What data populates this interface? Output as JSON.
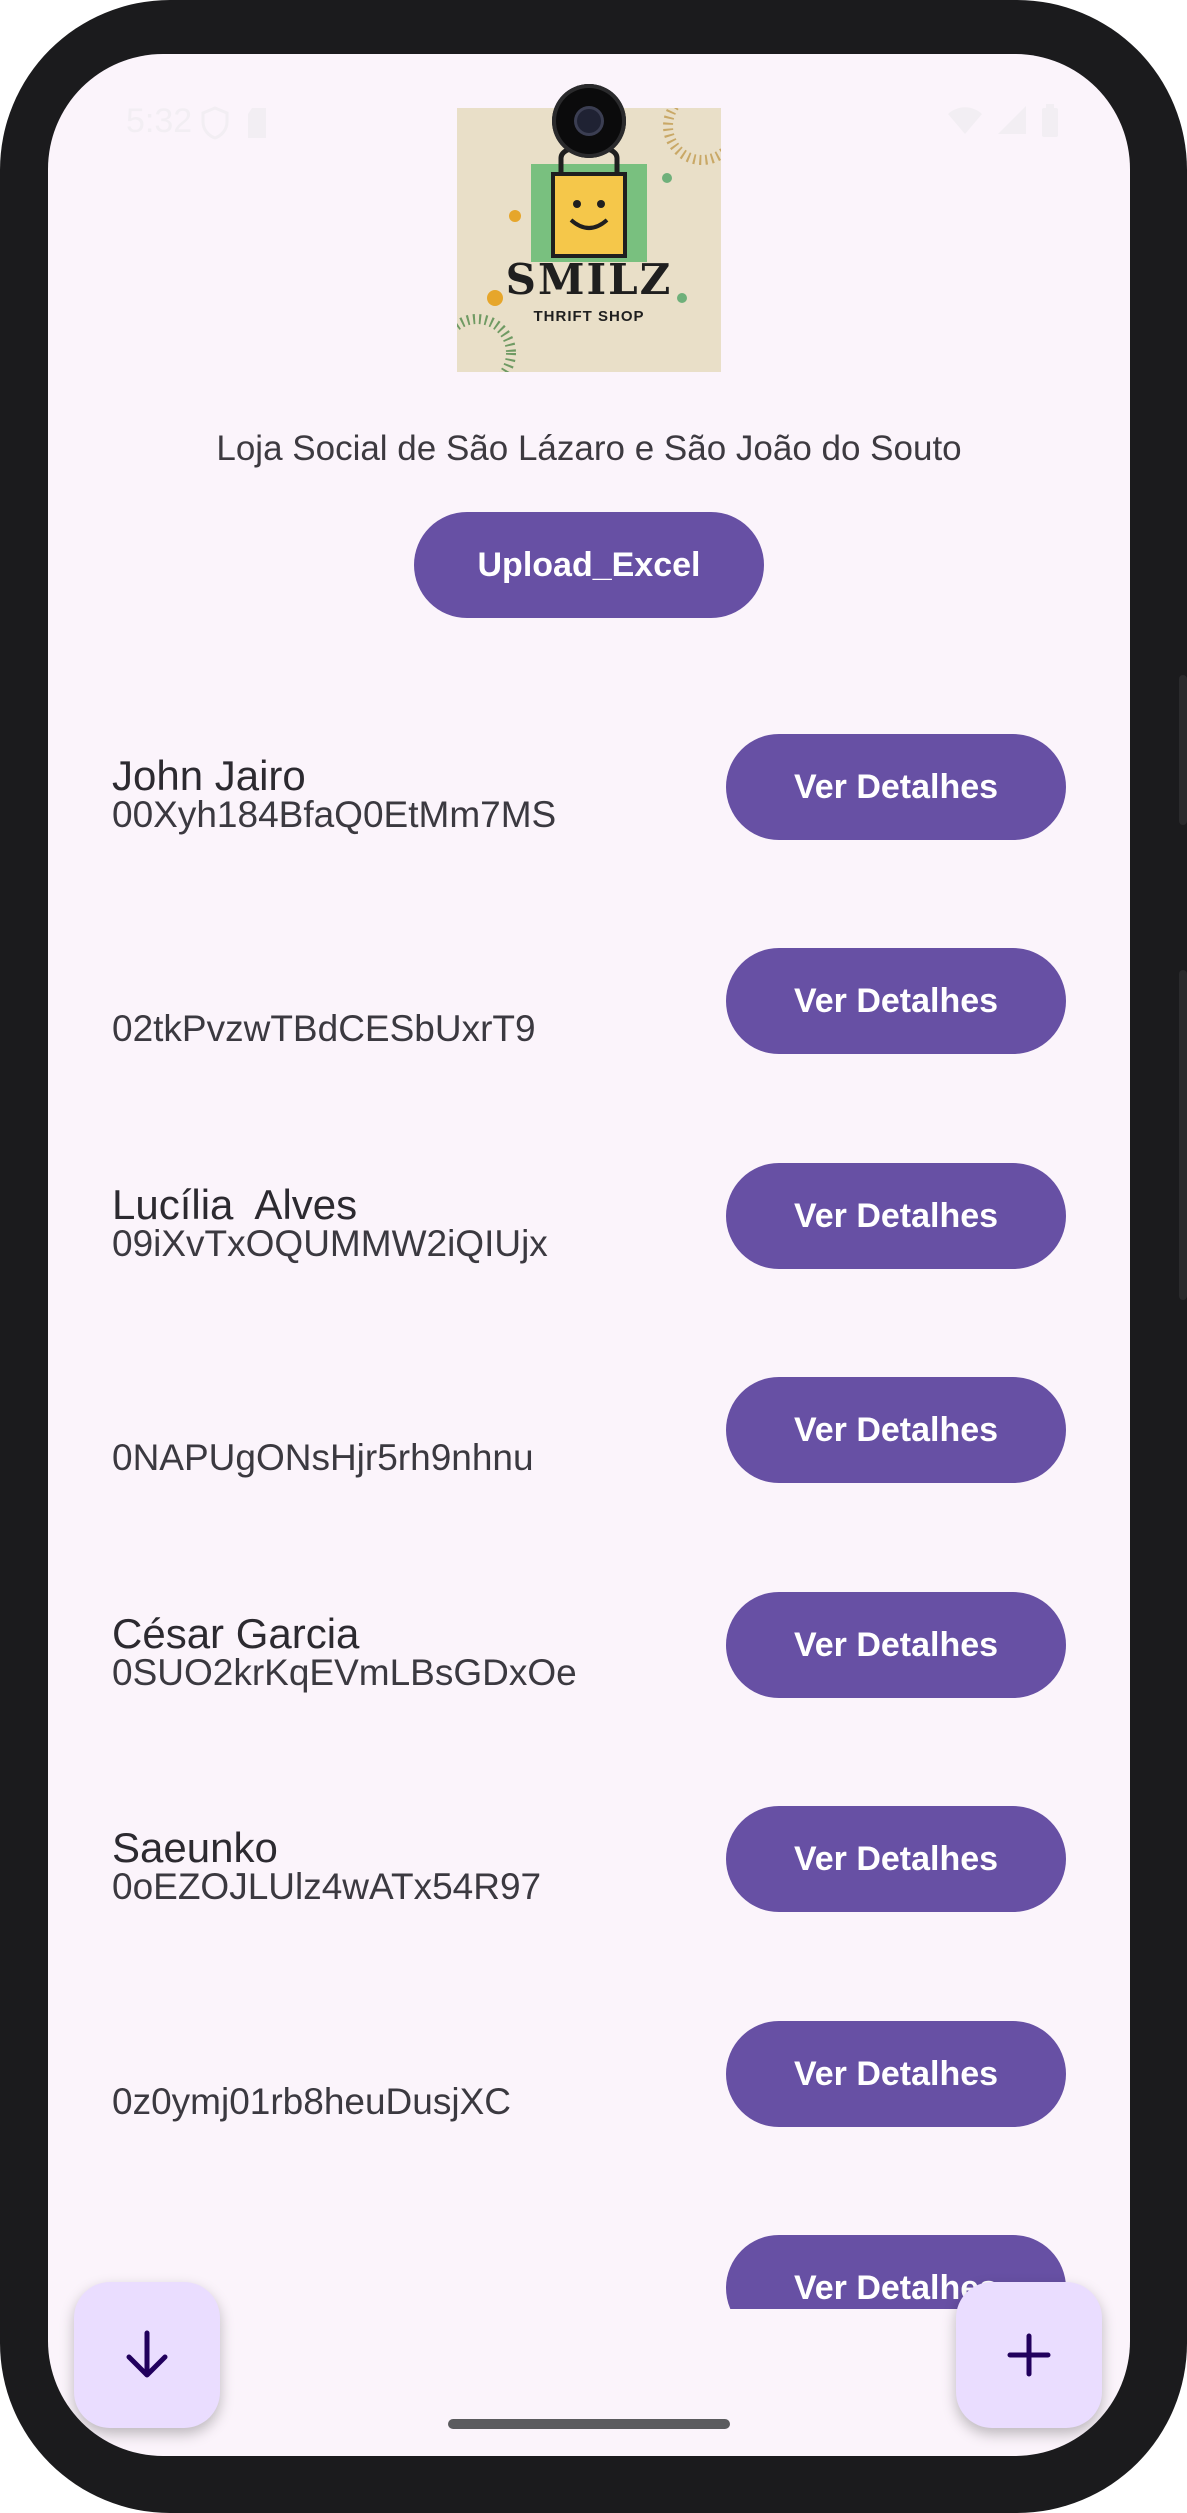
{
  "status_bar": {
    "time": "5:32"
  },
  "logo": {
    "title": "SMILZ",
    "subtitle": "THRIFT SHOP"
  },
  "header": {
    "store_name": "Loja Social de São Lázaro e São João do Souto",
    "upload_label": "Upload_Excel"
  },
  "list": {
    "button_label": "Ver Detalhes",
    "items": [
      {
        "name": "John Jairo",
        "id": "00Xyh184BfaQ0EtMm7MS"
      },
      {
        "name": "",
        "id": "02tkPvzwTBdCESbUxrT9"
      },
      {
        "name": "Lucília  Alves",
        "id": "09iXvTxOQUMMW2iQIUjx"
      },
      {
        "name": "",
        "id": "0NAPUgONsHjr5rh9nhnu"
      },
      {
        "name": "César Garcia",
        "id": "0SUO2krKqEVmLBsGDxOe"
      },
      {
        "name": "Saeunko",
        "id": "0oEZOJLUlz4wATx54R97"
      },
      {
        "name": "",
        "id": "0z0ymj01rb8heuDusjXC"
      },
      {
        "name": "",
        "id": ""
      }
    ]
  },
  "fabs": {
    "left_icon": "arrow-down-icon",
    "right_icon": "plus-icon"
  },
  "colors": {
    "primary": "#6750a4",
    "background": "#fbf4fb",
    "fab_background": "#eaddff",
    "fab_icon": "#21005d"
  }
}
